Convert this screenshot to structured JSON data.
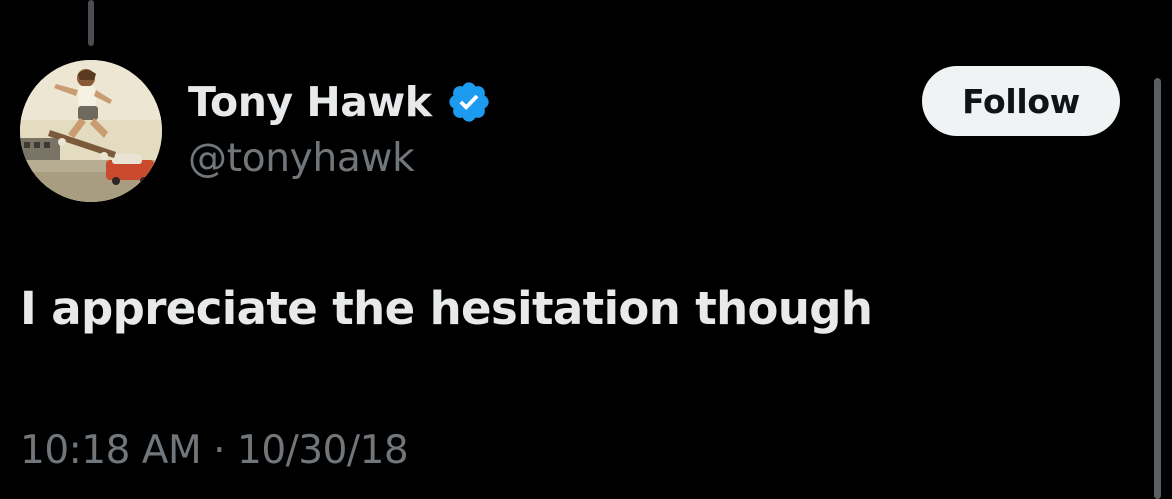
{
  "tweet": {
    "author": {
      "display_name": "Tony Hawk",
      "handle": "@tonyhawk",
      "verified": true,
      "avatar_icon": "skateboarder-photo-avatar"
    },
    "follow_label": "Follow",
    "text": "I appreciate the hesitation though",
    "time": "10:18 AM",
    "separator": "·",
    "date": "10/30/18"
  },
  "colors": {
    "background": "#000000",
    "primary_text": "#e7e9ea",
    "secondary_text": "#71767b",
    "verified_badge": "#1d9bf0",
    "follow_button_bg": "#eff3f4",
    "follow_button_text": "#0f1419"
  }
}
